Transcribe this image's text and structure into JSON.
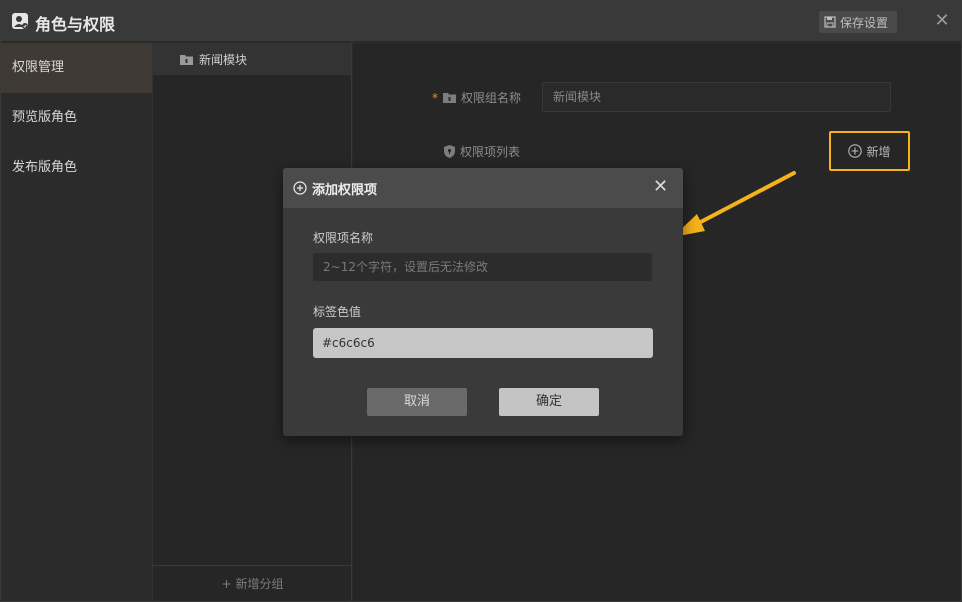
{
  "window": {
    "title": "角色与权限",
    "save_label": "保存设置",
    "close_glyph": "✕"
  },
  "sidebar": {
    "items": [
      {
        "label": "权限管理",
        "active": true
      },
      {
        "label": "预览版角色",
        "active": false
      },
      {
        "label": "发布版角色",
        "active": false
      }
    ]
  },
  "modules": {
    "items": [
      {
        "label": "新闻模块"
      }
    ],
    "add_group_label": "新增分组",
    "add_group_glyph": "+"
  },
  "main": {
    "required_mark": "*",
    "group_name_label": "权限组名称",
    "group_name_value": "新闻模块",
    "items_list_label": "权限项列表",
    "add_label": "新增",
    "highlight_color": "#f5b21a"
  },
  "dialog": {
    "title": "添加权限项",
    "close_glyph": "✕",
    "name_label": "权限项名称",
    "name_placeholder": "2~12个字符，设置后无法修改",
    "color_label": "标签色值",
    "color_value": "#c6c6c6",
    "cancel_label": "取消",
    "ok_label": "确定"
  }
}
